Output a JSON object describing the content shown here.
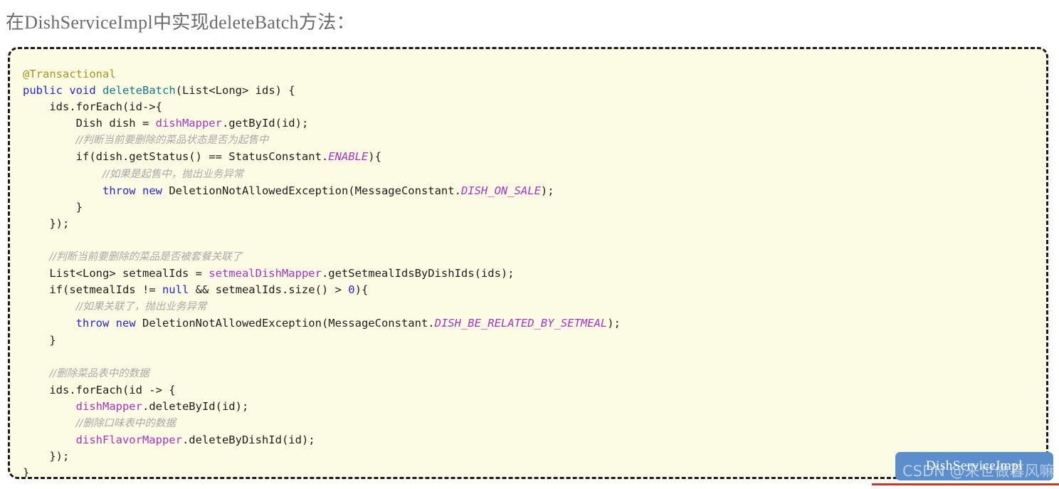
{
  "page": {
    "title": "在DishServiceImpl中实现deleteBatch方法：",
    "background_color": "#ffffff"
  },
  "code_card": {
    "background_color": "#fcfbe3",
    "border_color": "#1a1a1a",
    "border_style": "dashed",
    "language": "java",
    "theme_colors": {
      "annotation": "#a3971f",
      "keyword": "#2424d8",
      "method": "#16797f",
      "field": "#a635c4",
      "constant": "#a635c4",
      "comment": "#a8a8a8",
      "number": "#2424d8",
      "plain": "#1d1d1d"
    },
    "lines": [
      {
        "indent": 0,
        "tokens": [
          {
            "t": "annotation",
            "v": "@Transactional"
          }
        ]
      },
      {
        "indent": 0,
        "tokens": [
          {
            "t": "keyword",
            "v": "public"
          },
          {
            "t": "plain",
            "v": " "
          },
          {
            "t": "keyword",
            "v": "void"
          },
          {
            "t": "plain",
            "v": " "
          },
          {
            "t": "method",
            "v": "deleteBatch"
          },
          {
            "t": "plain",
            "v": "(List<Long> ids) {"
          }
        ]
      },
      {
        "indent": 1,
        "tokens": [
          {
            "t": "plain",
            "v": "ids.forEach(id->{"
          }
        ]
      },
      {
        "indent": 2,
        "tokens": [
          {
            "t": "plain",
            "v": "Dish dish = "
          },
          {
            "t": "field",
            "v": "dishMapper"
          },
          {
            "t": "plain",
            "v": ".getById(id);"
          }
        ]
      },
      {
        "indent": 2,
        "tokens": [
          {
            "t": "comment",
            "v": "//判断当前要删除的菜品状态是否为起售中"
          }
        ]
      },
      {
        "indent": 2,
        "tokens": [
          {
            "t": "plain",
            "v": "if(dish.getStatus() == StatusConstant."
          },
          {
            "t": "constant",
            "v": "ENABLE"
          },
          {
            "t": "plain",
            "v": "){"
          }
        ]
      },
      {
        "indent": 3,
        "tokens": [
          {
            "t": "comment",
            "v": "//如果是起售中，抛出业务异常"
          }
        ]
      },
      {
        "indent": 3,
        "tokens": [
          {
            "t": "keyword",
            "v": "throw"
          },
          {
            "t": "plain",
            "v": " "
          },
          {
            "t": "keyword",
            "v": "new"
          },
          {
            "t": "plain",
            "v": " DeletionNotAllowedException(MessageConstant."
          },
          {
            "t": "constant",
            "v": "DISH_ON_SALE"
          },
          {
            "t": "plain",
            "v": ");"
          }
        ]
      },
      {
        "indent": 2,
        "tokens": [
          {
            "t": "plain",
            "v": "}"
          }
        ]
      },
      {
        "indent": 1,
        "tokens": [
          {
            "t": "plain",
            "v": "});"
          }
        ]
      },
      {
        "indent": 0,
        "tokens": []
      },
      {
        "indent": 1,
        "tokens": [
          {
            "t": "comment",
            "v": "//判断当前要删除的菜品是否被套餐关联了"
          }
        ]
      },
      {
        "indent": 1,
        "tokens": [
          {
            "t": "plain",
            "v": "List<Long> setmealIds = "
          },
          {
            "t": "field",
            "v": "setmealDishMapper"
          },
          {
            "t": "plain",
            "v": ".getSetmealIdsByDishIds(ids);"
          }
        ]
      },
      {
        "indent": 1,
        "tokens": [
          {
            "t": "plain",
            "v": "if(setmealIds != "
          },
          {
            "t": "keyword",
            "v": "null"
          },
          {
            "t": "plain",
            "v": " && setmealIds.size() > "
          },
          {
            "t": "number",
            "v": "0"
          },
          {
            "t": "plain",
            "v": "){"
          }
        ]
      },
      {
        "indent": 2,
        "tokens": [
          {
            "t": "comment",
            "v": "//如果关联了，抛出业务异常"
          }
        ]
      },
      {
        "indent": 2,
        "tokens": [
          {
            "t": "keyword",
            "v": "throw"
          },
          {
            "t": "plain",
            "v": " "
          },
          {
            "t": "keyword",
            "v": "new"
          },
          {
            "t": "plain",
            "v": " DeletionNotAllowedException(MessageConstant."
          },
          {
            "t": "constant",
            "v": "DISH_BE_RELATED_BY_SETMEAL"
          },
          {
            "t": "plain",
            "v": ");"
          }
        ]
      },
      {
        "indent": 1,
        "tokens": [
          {
            "t": "plain",
            "v": "}"
          }
        ]
      },
      {
        "indent": 0,
        "tokens": []
      },
      {
        "indent": 1,
        "tokens": [
          {
            "t": "comment",
            "v": "//删除菜品表中的数据"
          }
        ]
      },
      {
        "indent": 1,
        "tokens": [
          {
            "t": "plain",
            "v": "ids.forEach(id -> {"
          }
        ]
      },
      {
        "indent": 2,
        "tokens": [
          {
            "t": "field",
            "v": "dishMapper"
          },
          {
            "t": "plain",
            "v": ".deleteById(id);"
          }
        ]
      },
      {
        "indent": 2,
        "tokens": [
          {
            "t": "comment",
            "v": "//删除口味表中的数据"
          }
        ]
      },
      {
        "indent": 2,
        "tokens": [
          {
            "t": "field",
            "v": "dishFlavorMapper"
          },
          {
            "t": "plain",
            "v": ".deleteByDishId(id);"
          }
        ]
      },
      {
        "indent": 1,
        "tokens": [
          {
            "t": "plain",
            "v": "});"
          }
        ]
      },
      {
        "indent": 0,
        "tokens": [
          {
            "t": "plain",
            "v": "}"
          }
        ]
      }
    ]
  },
  "tooltip_badge": {
    "label": "DishServiceImpl",
    "background_color": "#5b8ecb",
    "text_color": "#ffffff"
  },
  "watermark": {
    "text": "CSDN @来世做暮风嘛",
    "color": "#ffffff"
  },
  "bottom_rule": {
    "color": "#c0392b"
  }
}
